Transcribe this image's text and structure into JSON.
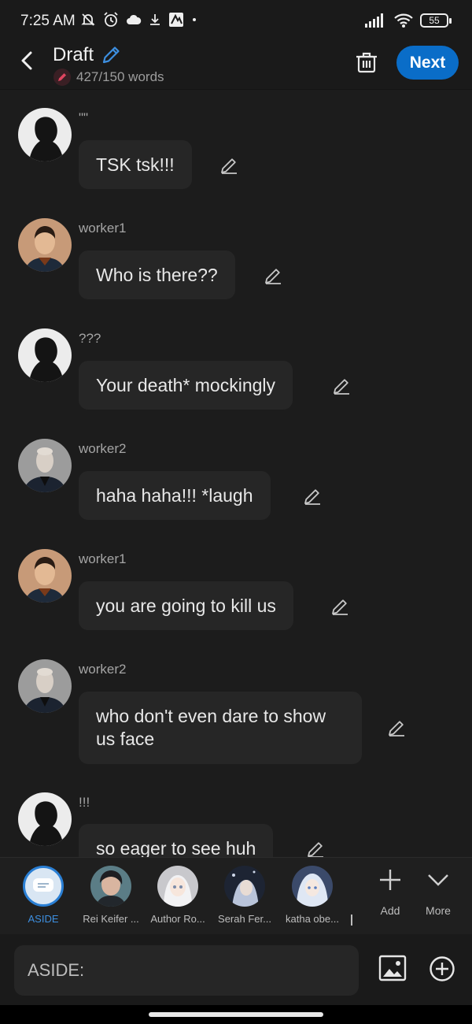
{
  "status_bar": {
    "time": "7:25 AM",
    "battery": "55"
  },
  "header": {
    "title": "Draft",
    "word_count": "427/150 words",
    "next_label": "Next"
  },
  "messages": [
    {
      "author": "\"\"",
      "text": "TSK tsk!!!",
      "avatar": "silhouette"
    },
    {
      "author": "worker1",
      "text": "Who is there??",
      "avatar": "worker1"
    },
    {
      "author": "???",
      "text": "Your death* mockingly",
      "avatar": "silhouette"
    },
    {
      "author": "worker2",
      "text": "haha haha!!! *laugh",
      "avatar": "worker2"
    },
    {
      "author": "worker1",
      "text": "you are going to kill us",
      "avatar": "worker1"
    },
    {
      "author": "worker2",
      "text": "who don't even dare to show us face",
      "avatar": "worker2"
    },
    {
      "author": "!!!",
      "text": "so eager to see huh",
      "avatar": "silhouette"
    }
  ],
  "personas": [
    {
      "label": "ASIDE"
    },
    {
      "label": "Rei Keifer ..."
    },
    {
      "label": "Author Ro..."
    },
    {
      "label": "Serah Fer..."
    },
    {
      "label": "katha obe..."
    }
  ],
  "tools": {
    "add_label": "Add",
    "more_label": "More"
  },
  "composer": {
    "placeholder": "ASIDE:"
  },
  "colors": {
    "accent": "#0a6dc8",
    "background": "#1c1c1c",
    "bubble": "#262626"
  }
}
